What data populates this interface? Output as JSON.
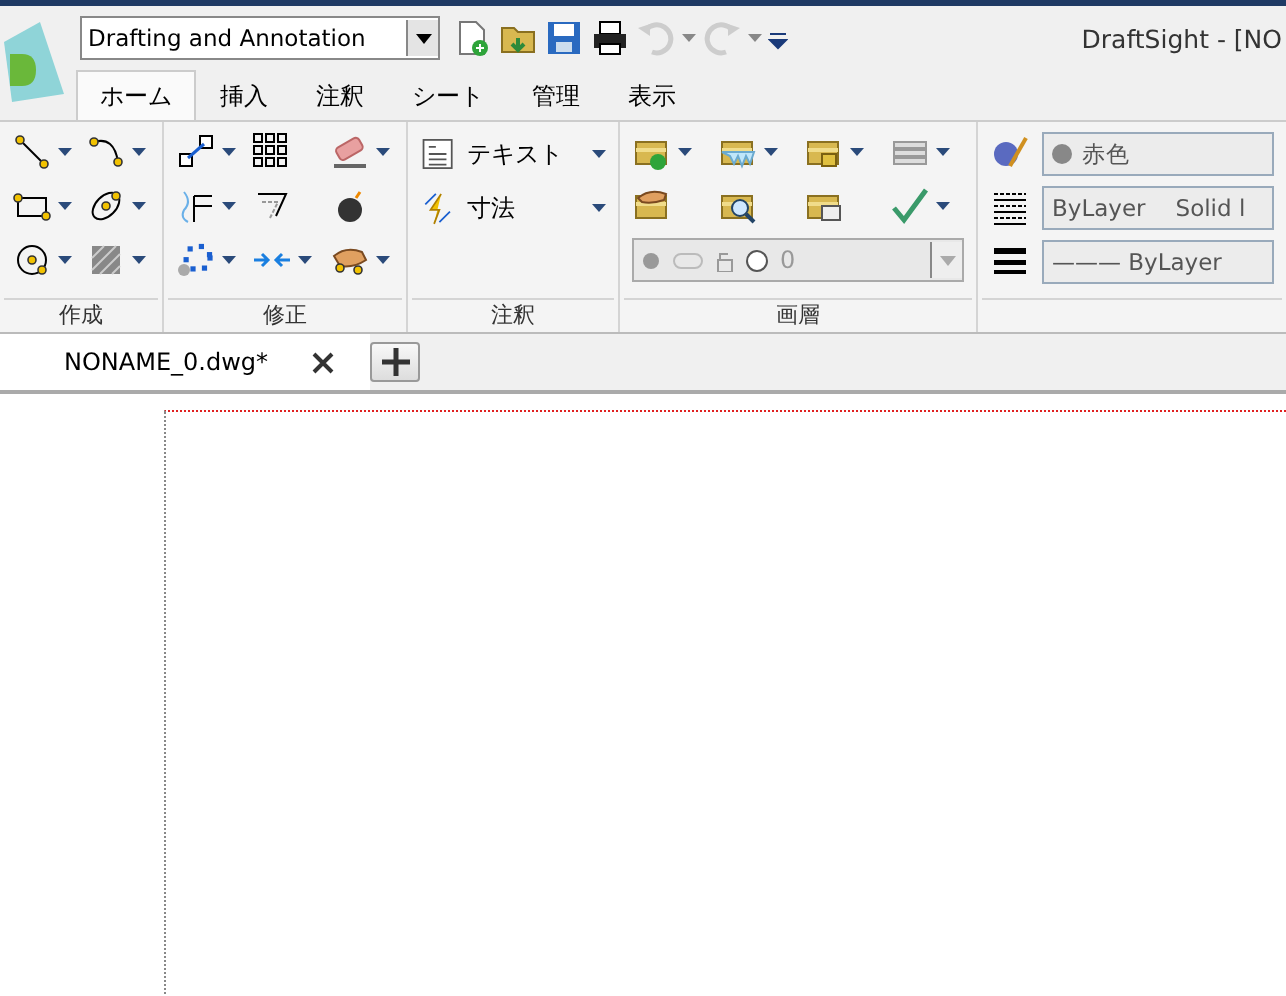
{
  "window": {
    "title": "DraftSight - [NO"
  },
  "workspace": {
    "value": "Drafting and Annotation"
  },
  "quick_access": [
    {
      "disabled": false,
      "menu": false
    },
    {
      "disabled": false,
      "menu": false
    },
    {
      "disabled": false,
      "menu": false
    },
    {
      "disabled": false,
      "menu": false
    },
    {
      "disabled": true,
      "menu": true
    },
    {
      "disabled": true,
      "menu": true
    },
    {
      "disabled": false,
      "menu": false
    }
  ],
  "tabs": [
    {
      "label": "ホーム",
      "selected": true
    },
    {
      "label": "挿入",
      "selected": false
    },
    {
      "label": "注釈",
      "selected": false
    },
    {
      "label": "シート",
      "selected": false
    },
    {
      "label": "管理",
      "selected": false
    },
    {
      "label": "表示",
      "selected": false
    }
  ],
  "panels": [
    {
      "title": "作成",
      "kind": "grid",
      "tools": [
        {
          "menu": true
        },
        {
          "menu": true
        },
        {
          "menu": true
        },
        {
          "menu": true
        },
        {
          "menu": true
        },
        {
          "menu": true
        }
      ]
    },
    {
      "title": "修正",
      "kind": "grid",
      "tools": [
        {
          "menu": true
        },
        {
          "menu": false
        },
        {
          "menu": true
        },
        {
          "menu": true
        },
        {
          "menu": false
        },
        {
          "menu": false
        },
        {
          "menu": true
        },
        {
          "menu": true
        },
        {
          "menu": true
        }
      ]
    },
    {
      "title": "注釈",
      "kind": "labeled",
      "tools": [
        {
          "label": "テキスト",
          "menu": true
        },
        {
          "label": "寸法",
          "menu": true
        }
      ]
    },
    {
      "title": "画層",
      "kind": "layer",
      "tools": [
        {
          "menu": true
        },
        {
          "menu": true
        },
        {
          "menu": true
        },
        {
          "menu": true
        },
        {
          "menu": false
        },
        {
          "menu": false
        },
        {
          "menu": false
        },
        {
          "menu": true
        }
      ],
      "layer_combo": {
        "value": "0"
      }
    },
    {
      "kind": "properties",
      "rows": [
        {
          "value": "赤色"
        },
        {
          "value": "ByLayer",
          "extra": "Solid l"
        },
        {
          "value": "——— ByLayer"
        }
      ]
    }
  ],
  "document_tabs": [
    {
      "label": "NONAME_0.dwg*",
      "selected": true
    }
  ]
}
